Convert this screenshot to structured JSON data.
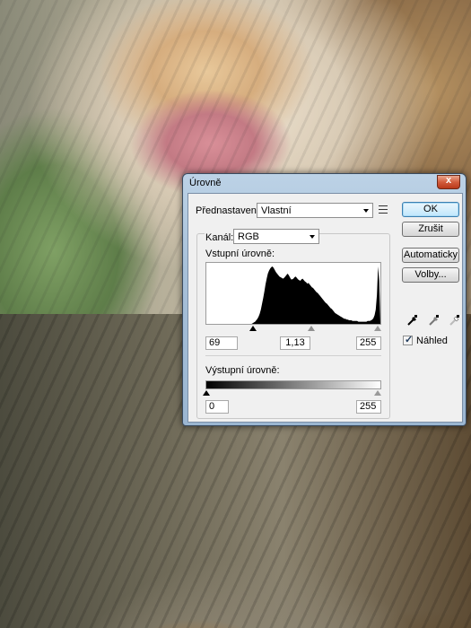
{
  "dialog": {
    "title": "Úrovně",
    "close_label": "x"
  },
  "preset": {
    "label": "Přednastavení:",
    "value": "Vlastní"
  },
  "channel": {
    "label": "Kanál:",
    "value": "RGB"
  },
  "input_levels": {
    "label": "Vstupní úrovně:",
    "black": "69",
    "gamma": "1,13",
    "white": "255"
  },
  "output_levels": {
    "label": "Výstupní úrovně:",
    "black": "0",
    "white": "255"
  },
  "buttons": {
    "ok": "OK",
    "cancel": "Zrušit",
    "auto": "Automaticky",
    "options": "Volby..."
  },
  "preview": {
    "label": "Náhled",
    "checked": true
  },
  "histogram": {
    "bins": [
      0,
      0,
      0,
      0,
      0,
      0,
      0,
      0,
      0,
      0,
      0,
      0,
      0,
      0,
      0,
      0,
      0,
      0,
      0,
      0,
      0,
      0,
      0,
      0,
      0,
      0,
      0,
      0,
      0,
      0,
      0,
      0,
      0,
      0,
      0,
      0,
      0,
      0,
      0,
      0,
      1,
      2,
      3,
      5,
      7,
      10,
      14,
      20,
      28,
      36,
      45,
      55,
      63,
      70,
      74,
      77,
      79,
      80,
      78,
      75,
      72,
      70,
      68,
      66,
      65,
      64,
      63,
      64,
      66,
      68,
      70,
      68,
      65,
      62,
      62,
      63,
      65,
      66,
      64,
      62,
      61,
      60,
      62,
      63,
      61,
      59,
      58,
      56,
      57,
      55,
      53,
      51,
      50,
      48,
      46,
      44,
      43,
      41,
      39,
      37,
      35,
      33,
      31,
      29,
      28,
      26,
      24,
      22,
      21,
      19,
      17,
      15,
      14,
      13,
      12,
      11,
      10,
      9,
      8,
      7,
      7,
      6,
      6,
      5,
      5,
      5,
      4,
      4,
      4,
      4,
      4,
      3,
      3,
      3,
      3,
      3,
      3,
      3,
      3,
      4,
      4,
      4,
      5,
      6,
      8,
      12,
      20,
      40,
      80,
      60,
      0
    ]
  }
}
